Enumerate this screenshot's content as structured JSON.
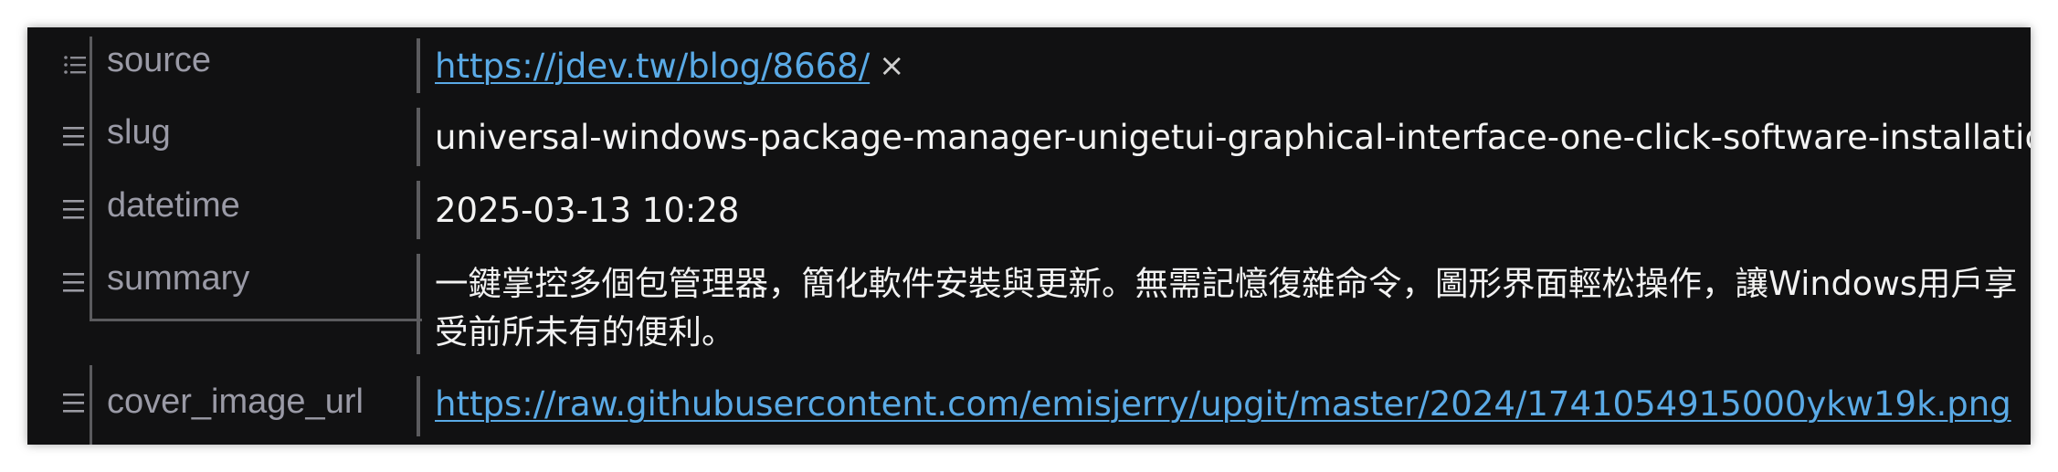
{
  "properties": [
    {
      "key": "source",
      "value": "https://jdev.tw/blog/8668/",
      "value_type": "link",
      "remove_glyph": "×"
    },
    {
      "key": "slug",
      "value": "universal-windows-package-manager-unigetui-graphical-interface-one-click-software-installation",
      "value_type": "text"
    },
    {
      "key": "datetime",
      "value": "2025-03-13 10:28",
      "value_type": "text"
    },
    {
      "key": "summary",
      "value": "一鍵掌控多個包管理器，簡化軟件安裝與更新。無需記憶復雜命令，圖形界面輕松操作，讓Windows用戶享受前所未有的便利。",
      "value_type": "text"
    },
    {
      "key": "cover_image_url",
      "value": "https://raw.githubusercontent.com/emisjerry/upgit/master/2024/1741054915000ykw19k.png",
      "value_type": "link"
    }
  ],
  "icons": {
    "drag_handle": "list-drag-handle-icon",
    "remove": "close-icon"
  },
  "colors": {
    "background": "#111112",
    "key_text": "#9a9aa6",
    "value_text": "#f2f2f2",
    "link": "#5aaae6",
    "divider": "#5b5b5e"
  }
}
